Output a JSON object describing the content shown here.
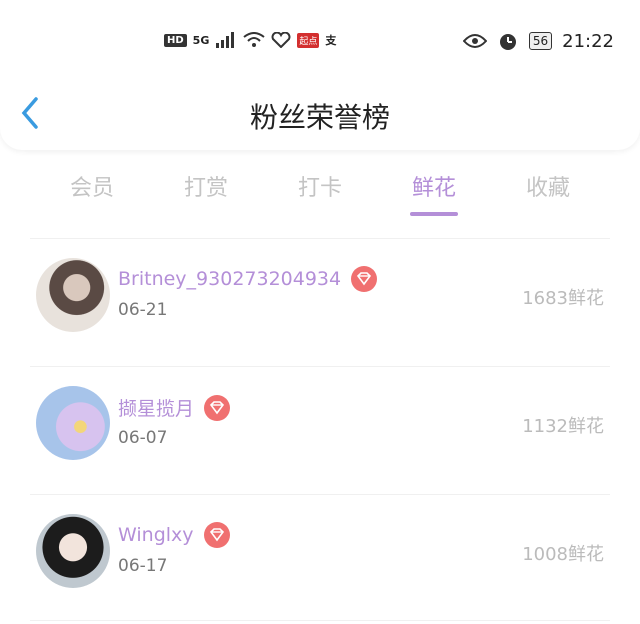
{
  "status_bar": {
    "hd": "HD",
    "network": "5G",
    "qidian": "起点",
    "alipay": "支",
    "battery": "56",
    "time": "21:22"
  },
  "header": {
    "title": "粉丝荣誉榜"
  },
  "tabs": [
    {
      "label": "会员",
      "active": false
    },
    {
      "label": "打赏",
      "active": false
    },
    {
      "label": "打卡",
      "active": false
    },
    {
      "label": "鲜花",
      "active": true
    },
    {
      "label": "收藏",
      "active": false
    }
  ],
  "list": [
    {
      "name": "Britney_930273204934",
      "date": "06-21",
      "count": "1683鲜花"
    },
    {
      "name": "撷星揽月",
      "date": "06-07",
      "count": "1132鲜花"
    },
    {
      "name": "Winglxy",
      "date": "06-17",
      "count": "1008鲜花"
    }
  ],
  "colors": {
    "accent": "#b48fd8",
    "back": "#3a9be0",
    "badge": "#f07070"
  }
}
